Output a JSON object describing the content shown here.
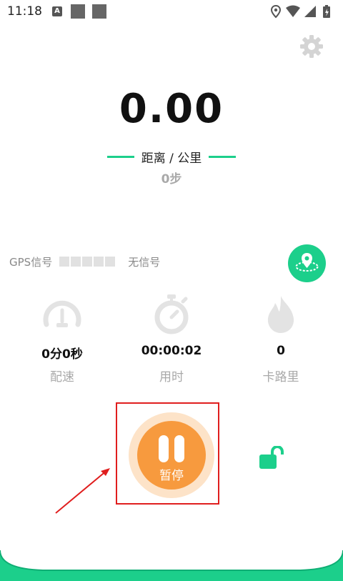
{
  "status_bar": {
    "time": "11:18",
    "a_icon_letter": "A",
    "icons": [
      "a-notification-icon",
      "square-icon",
      "square-icon",
      "location-icon",
      "wifi-icon",
      "signal-icon",
      "battery-icon"
    ]
  },
  "header": {
    "settings_icon": "gear-icon"
  },
  "distance": {
    "value": "0.00",
    "unit_label": "距离 / 公里"
  },
  "steps": {
    "text": "0步"
  },
  "gps": {
    "label": "GPS信号",
    "bar_count": 5,
    "bars_filled": 0,
    "status": "无信号"
  },
  "stats": [
    {
      "icon": "speedometer-icon",
      "value": "0分0秒",
      "label": "配速"
    },
    {
      "icon": "stopwatch-icon",
      "value": "00:00:02",
      "label": "用时"
    },
    {
      "icon": "flame-icon",
      "value": "0",
      "label": "卡路里"
    }
  ],
  "controls": {
    "pause_label": "暂停",
    "lock_icon": "unlock-icon"
  },
  "colors": {
    "accent_green": "#1ccf8b",
    "pause_orange": "#f79a3e",
    "pause_ring": "#fde3c8",
    "icon_gray": "#e3e3e3",
    "highlight_red": "#e01e1e"
  }
}
